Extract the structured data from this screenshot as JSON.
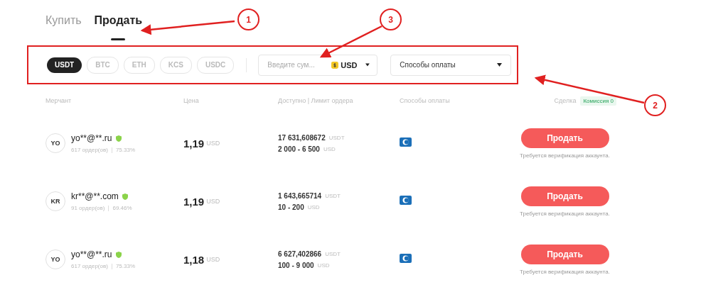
{
  "tabs": [
    {
      "label": "Купить",
      "selected": false
    },
    {
      "label": "Продать",
      "selected": true
    }
  ],
  "filters": {
    "coins": [
      {
        "label": "USDT",
        "selected": true
      },
      {
        "label": "BTC",
        "selected": false
      },
      {
        "label": "ETH",
        "selected": false
      },
      {
        "label": "KCS",
        "selected": false
      },
      {
        "label": "USDC",
        "selected": false
      }
    ],
    "amount": {
      "placeholder": "Введите сум...",
      "currency": "USD"
    },
    "payment": {
      "value": "Способы оплаты"
    }
  },
  "table": {
    "columns": [
      "Мерчант",
      "Цена",
      "Доступно | Лимит ордера",
      "Способы оплаты",
      "Сделка"
    ],
    "commission": "Комиссия 0",
    "rows": [
      {
        "avatar": "YO",
        "name": "yo**@**.ru",
        "orders": "617 ордер(ов)",
        "rate": "75.33%",
        "price": "1,19",
        "price_currency": "USD",
        "available": "17 631,608672",
        "available_currency": "USDT",
        "limit": "2 000 - 6 500",
        "limit_currency": "USD",
        "action": "Продать",
        "note": "Требуется верификация аккаунта."
      },
      {
        "avatar": "KR",
        "name": "kr**@**.com",
        "orders": "91 ордер(ов)",
        "rate": "69.46%",
        "price": "1,19",
        "price_currency": "USD",
        "available": "1 643,665714",
        "available_currency": "USDT",
        "limit": "10 - 200",
        "limit_currency": "USD",
        "action": "Продать",
        "note": "Требуется верификация аккаунта."
      },
      {
        "avatar": "YO",
        "name": "yo**@**.ru",
        "orders": "617 ордер(ов)",
        "rate": "75.33%",
        "price": "1,18",
        "price_currency": "USD",
        "available": "6 627,402866",
        "available_currency": "USDT",
        "limit": "100 - 9 000",
        "limit_currency": "USD",
        "action": "Продать",
        "note": "Требуется верификация аккаунта."
      }
    ]
  },
  "annotations": [
    "1",
    "3",
    "2"
  ]
}
